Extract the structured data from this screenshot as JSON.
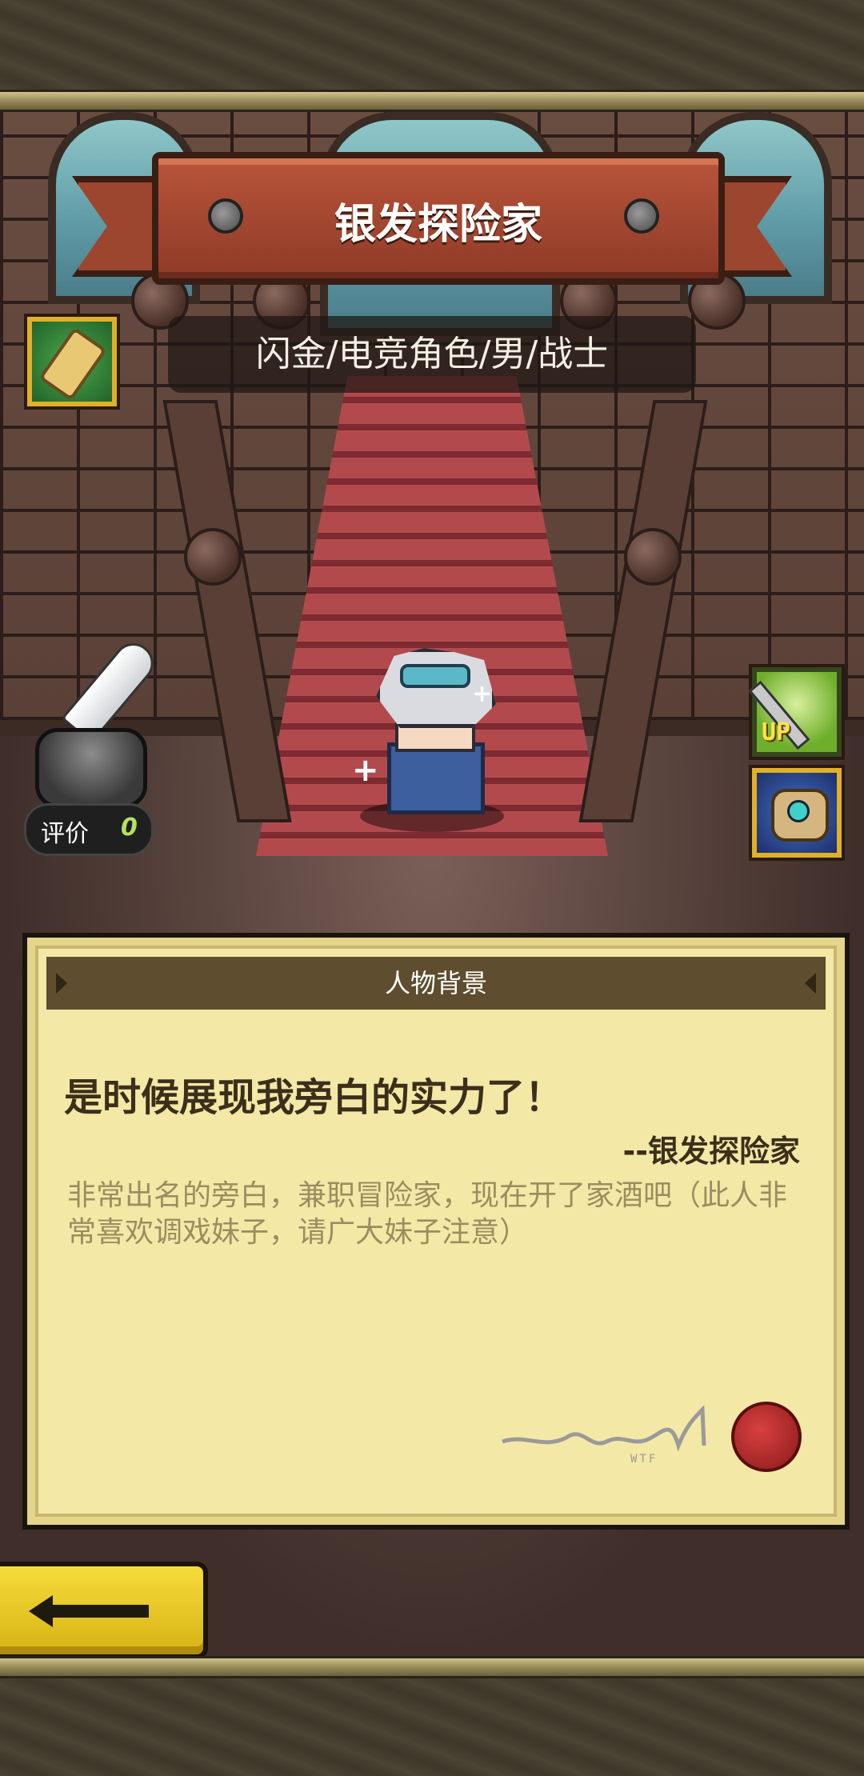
{
  "character": {
    "name": "银发探险家",
    "tags": "闪金/电竞角色/男/战士"
  },
  "rating": {
    "label": "评价",
    "value": "0"
  },
  "skills": [
    {
      "icon": "sword-up-icon",
      "text": "UP"
    },
    {
      "icon": "gauntlet-icon"
    }
  ],
  "panel": {
    "header": "人物背景",
    "quote": "是时候展现我旁白的实力了！",
    "quote_author": "--银发探险家",
    "bio": "非常出名的旁白，兼职冒险家，现在开了家酒吧（此人非常喜欢调戏妹子，请广大妹子注意）",
    "signature_mark": "WTF"
  },
  "colors": {
    "banner": "#a8472f",
    "panel": "#f4e8a6",
    "panel_header": "#5e4d2e",
    "back_button": "#f0d020",
    "rating_value": "#b8e060"
  }
}
